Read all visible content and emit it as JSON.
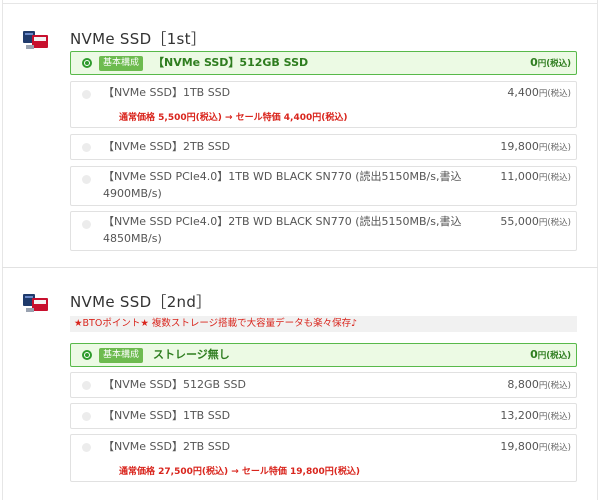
{
  "sections": [
    {
      "title": "NVMe  SSD［1st］",
      "options": [
        {
          "badge": "基本構成",
          "label": "【NVMe SSD】512GB SSD",
          "price": "0",
          "tax": "円(税込)",
          "selected": true
        },
        {
          "label": "【NVMe SSD】1TB SSD",
          "price": "4,400",
          "tax": "円(税込)",
          "sale_note": "通常価格 5,500円(税込) → セール特価 4,400円(税込)"
        },
        {
          "label": "【NVMe SSD】2TB SSD",
          "price": "19,800",
          "tax": "円(税込)"
        },
        {
          "label_line1": "【NVMe SSD PCIe4.0】1TB WD BLACK SN770 (読出5150MB/s,書込",
          "label_line2": "4900MB/s)",
          "price": "11,000",
          "tax": "円(税込)"
        },
        {
          "label_line1": "【NVMe SSD PCIe4.0】2TB WD BLACK SN770 (読出5150MB/s,書込",
          "label_line2": "4850MB/s)",
          "price": "55,000",
          "tax": "円(税込)"
        }
      ]
    },
    {
      "title": "NVMe  SSD［2nd］",
      "note": "★BTOポイント★ 複数ストレージ搭載で大容量データも楽々保存♪",
      "options": [
        {
          "badge": "基本構成",
          "label": "ストレージ無し",
          "price": "0",
          "tax": "円(税込)",
          "selected": true
        },
        {
          "label": "【NVMe SSD】512GB SSD",
          "price": "8,800",
          "tax": "円(税込)"
        },
        {
          "label": "【NVMe SSD】1TB SSD",
          "price": "13,200",
          "tax": "円(税込)"
        },
        {
          "label": "【NVMe SSD】2TB SSD",
          "price": "19,800",
          "tax": "円(税込)",
          "sale_note": "通常価格 27,500円(税込) → セール特価 19,800円(税込)"
        }
      ]
    }
  ]
}
